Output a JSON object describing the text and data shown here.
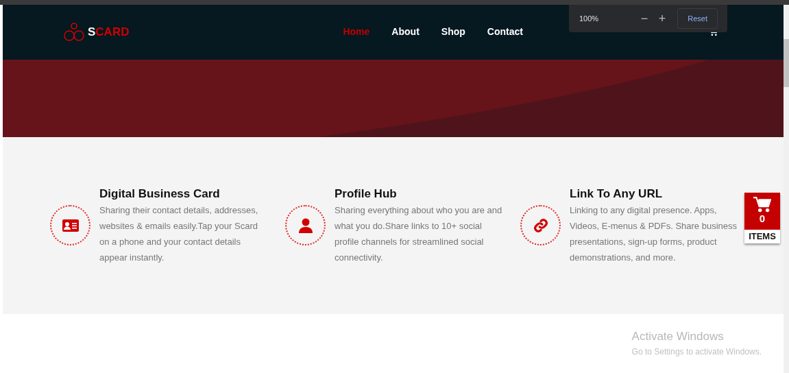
{
  "logo": {
    "first": "S",
    "rest": "CARD"
  },
  "nav": [
    {
      "label": "Home",
      "selected": true
    },
    {
      "label": "About",
      "selected": false
    },
    {
      "label": "Shop",
      "selected": false
    },
    {
      "label": "Contact",
      "selected": false
    }
  ],
  "zoom_popup": {
    "level": "100%",
    "minus": "−",
    "plus": "+",
    "reset": "Reset"
  },
  "features": [
    {
      "kind": "card",
      "title": "Digital Business Card",
      "text": "Sharing their contact details, addresses, websites & emails easily.Tap your Scard on a phone and your contact details appear instantly."
    },
    {
      "kind": "person",
      "title": "Profile Hub",
      "text": "Sharing everything about who you are and what you do.Share links to 10+ social profile channels for streamlined social connectivity."
    },
    {
      "kind": "link",
      "title": "Link To Any URL",
      "text": "Linking to any digital presence. Apps, Videos, E-menus & PDFs. Share business presentations, sign-up forms, product demonstrations, and more."
    }
  ],
  "cart_widget": {
    "count": "0",
    "label": "ITEMS"
  },
  "activation_notice": {
    "title": "Activate Windows",
    "subtitle": "Go to Settings to activate Windows."
  }
}
